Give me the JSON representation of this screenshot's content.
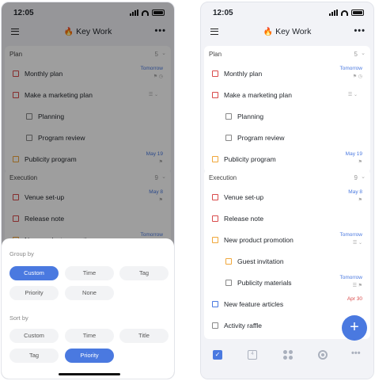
{
  "status": {
    "time": "12:05"
  },
  "header": {
    "emoji": "🔥",
    "title": "Key Work",
    "more": "•••"
  },
  "left": {
    "sections": [
      {
        "name": "Plan",
        "count": "5",
        "tasks": [
          {
            "label": "Monthly plan",
            "date": "Tomorrow",
            "icons": "⚑ ◷",
            "color": "red",
            "level": 0
          },
          {
            "label": "Make a marketing plan",
            "sub": "☰ ⌄",
            "color": "red",
            "level": 0
          },
          {
            "label": "Planning",
            "color": "gray",
            "level": 1
          },
          {
            "label": "Program review",
            "color": "gray",
            "level": 1
          },
          {
            "label": "Publicity program",
            "date": "May 19",
            "icons": "⚑",
            "color": "orange",
            "level": 0
          }
        ]
      },
      {
        "name": "Execution",
        "count": "9",
        "tasks": [
          {
            "label": "Venue set-up",
            "date": "May 8",
            "icons": "⚑",
            "color": "red",
            "level": 0
          },
          {
            "label": "Release note",
            "color": "red",
            "level": 0
          },
          {
            "label": "New product promotion",
            "date": "Tomorrow",
            "color": "orange",
            "level": 0
          }
        ]
      }
    ],
    "sheet": {
      "group_by_label": "Group by",
      "group_by": [
        "Custom",
        "Time",
        "Tag",
        "Priority",
        "None"
      ],
      "group_selected": "Custom",
      "sort_by_label": "Sort by",
      "sort_by": [
        "Custom",
        "Time",
        "Title",
        "Tag",
        "Priority"
      ],
      "sort_selected": "Priority"
    }
  },
  "right": {
    "sections": [
      {
        "name": "Plan",
        "count": "5",
        "tasks": [
          {
            "label": "Monthly plan",
            "date": "Tomorrow",
            "icons": "⚑ ◷",
            "color": "red",
            "level": 0
          },
          {
            "label": "Make a marketing plan",
            "sub": "☰ ⌄",
            "color": "red",
            "level": 0
          },
          {
            "label": "Planning",
            "color": "gray",
            "level": 1
          },
          {
            "label": "Program review",
            "color": "gray",
            "level": 1
          },
          {
            "label": "Publicity program",
            "date": "May 19",
            "icons": "⚑",
            "color": "orange",
            "level": 0
          }
        ]
      },
      {
        "name": "Execution",
        "count": "9",
        "tasks": [
          {
            "label": "Venue set-up",
            "date": "May 8",
            "icons": "⚑",
            "color": "red",
            "level": 0
          },
          {
            "label": "Release note",
            "color": "red",
            "level": 0
          },
          {
            "label": "New product promotion",
            "date": "Tomorrow",
            "icons": "☰ ⌄",
            "color": "orange",
            "level": 0
          },
          {
            "label": "Guest invitation",
            "color": "orange",
            "level": 1
          },
          {
            "label": "Publicity materials",
            "date": "Tomorrow",
            "icons": "☰ ⚑",
            "color": "gray",
            "level": 1
          },
          {
            "label": "New feature articles",
            "date": "Apr 30",
            "date_color": "red",
            "color": "blue",
            "level": 0
          },
          {
            "label": "Activity raffle",
            "color": "gray",
            "level": 0
          }
        ]
      }
    ],
    "tabbar": {
      "calendar_day": "4",
      "fab": "+"
    }
  },
  "colors": {
    "accent": "#4a79e0",
    "red": "#d94b4b",
    "orange": "#f0a73a"
  }
}
